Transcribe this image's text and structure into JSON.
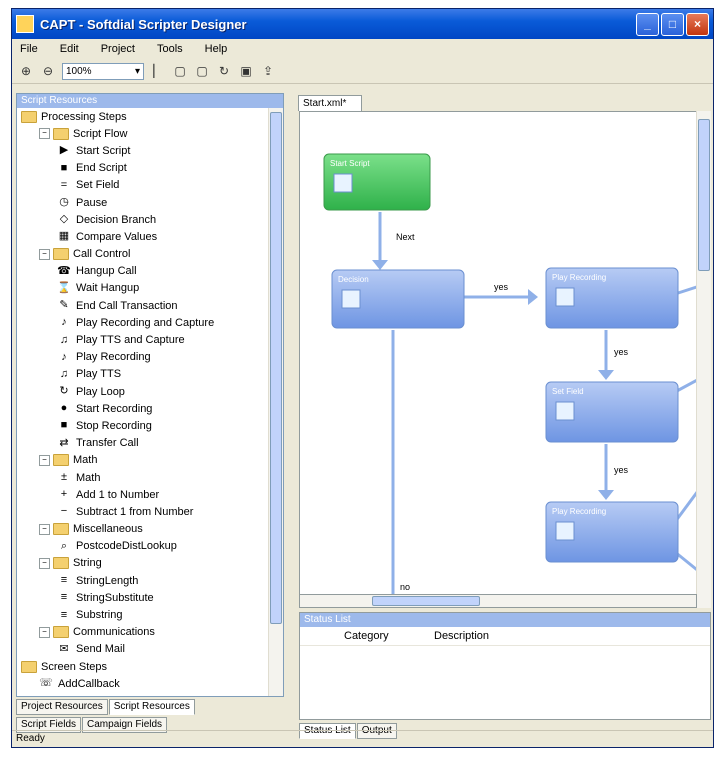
{
  "window": {
    "title": "CAPT - Softdial Scripter Designer"
  },
  "menu": [
    "File",
    "Edit",
    "Project",
    "Tools",
    "Help"
  ],
  "toolbar": {
    "zoom": "100%"
  },
  "left_panel": {
    "header": "Script Resources",
    "tree": [
      {
        "label": "Processing Steps",
        "level": 0,
        "type": "folder"
      },
      {
        "label": "Script Flow",
        "level": 1,
        "type": "folder",
        "expander": "−"
      },
      {
        "label": "Start Script",
        "level": 2,
        "icon": "▶"
      },
      {
        "label": "End Script",
        "level": 2,
        "icon": "■"
      },
      {
        "label": "Set Field",
        "level": 2,
        "icon": "="
      },
      {
        "label": "Pause",
        "level": 2,
        "icon": "◷"
      },
      {
        "label": "Decision Branch",
        "level": 2,
        "icon": "◇"
      },
      {
        "label": "Compare Values",
        "level": 2,
        "icon": "▦"
      },
      {
        "label": "Call Control",
        "level": 1,
        "type": "folder",
        "expander": "−"
      },
      {
        "label": "Hangup Call",
        "level": 2,
        "icon": "☎"
      },
      {
        "label": "Wait Hangup",
        "level": 2,
        "icon": "⌛"
      },
      {
        "label": "End Call Transaction",
        "level": 2,
        "icon": "✎"
      },
      {
        "label": "Play Recording and Capture",
        "level": 2,
        "icon": "♪"
      },
      {
        "label": "Play TTS and Capture",
        "level": 2,
        "icon": "♫"
      },
      {
        "label": "Play Recording",
        "level": 2,
        "icon": "♪"
      },
      {
        "label": "Play TTS",
        "level": 2,
        "icon": "♫"
      },
      {
        "label": "Play Loop",
        "level": 2,
        "icon": "↻"
      },
      {
        "label": "Start Recording",
        "level": 2,
        "icon": "●"
      },
      {
        "label": "Stop Recording",
        "level": 2,
        "icon": "■"
      },
      {
        "label": "Transfer Call",
        "level": 2,
        "icon": "⇄"
      },
      {
        "label": "Math",
        "level": 1,
        "type": "folder",
        "expander": "−"
      },
      {
        "label": "Math",
        "level": 2,
        "icon": "±"
      },
      {
        "label": "Add 1 to Number",
        "level": 2,
        "icon": "+"
      },
      {
        "label": "Subtract 1 from Number",
        "level": 2,
        "icon": "−"
      },
      {
        "label": "Miscellaneous",
        "level": 1,
        "type": "folder",
        "expander": "−"
      },
      {
        "label": "PostcodeDistLookup",
        "level": 2,
        "icon": "⌕"
      },
      {
        "label": "String",
        "level": 1,
        "type": "folder",
        "expander": "−"
      },
      {
        "label": "StringLength",
        "level": 2,
        "icon": "≡"
      },
      {
        "label": "StringSubstitute",
        "level": 2,
        "icon": "≡"
      },
      {
        "label": "Substring",
        "level": 2,
        "icon": "≡"
      },
      {
        "label": "Communications",
        "level": 1,
        "type": "folder",
        "expander": "−"
      },
      {
        "label": "Send Mail",
        "level": 2,
        "icon": "✉"
      },
      {
        "label": "Screen Steps",
        "level": 0,
        "type": "folder"
      },
      {
        "label": "AddCallback",
        "level": 1,
        "icon": "☏"
      }
    ],
    "tabs_row1": [
      "Project Resources",
      "Script Resources"
    ],
    "tabs_row2": [
      "Script Fields",
      "Campaign Fields"
    ]
  },
  "document": {
    "tab": "Start.xml*",
    "nodes": [
      {
        "label": "Start Script",
        "green": true
      },
      {
        "label": "Decision"
      },
      {
        "label": "Play Recording"
      },
      {
        "label": "Set Field"
      },
      {
        "label": "Play Recording"
      }
    ],
    "edge_labels": [
      "Next",
      "yes",
      "yes",
      "yes",
      "no"
    ]
  },
  "status_list": {
    "header": "Status List",
    "columns": [
      "Category",
      "Description"
    ]
  },
  "bottom_tabs": [
    "Status List",
    "Output"
  ],
  "statusbar": "Ready"
}
